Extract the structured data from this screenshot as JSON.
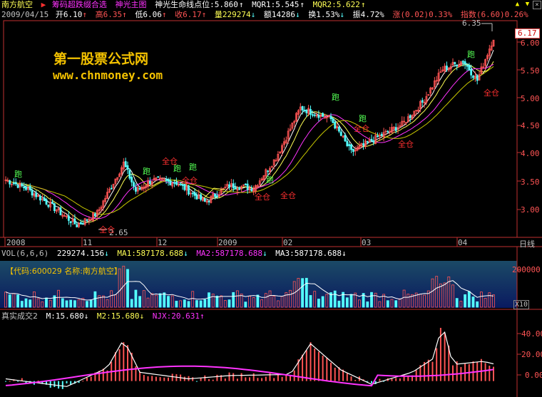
{
  "header": {
    "stock_name": "南方航空",
    "indicator_name": "筹码超跌缀合选",
    "main_chart_name": "神光主图",
    "lifeline_label": "神光生命线点位:",
    "lifeline_value": "5.860",
    "mqr1": "MQR1:5.545",
    "mqr2": "MQR2:5.622"
  },
  "quote": {
    "date": "2009/04/15",
    "open": "开6.10",
    "high": "高6.35",
    "low": "低6.06",
    "close": "收6.17",
    "volume": "量229274",
    "amount": "额14286",
    "turnover": "换1.53%",
    "amplitude": "振4.72%",
    "change": "涨(0.02)0.33%",
    "index": "指数(6.60)0.26%"
  },
  "watermark": {
    "line1": "第一股票公式网",
    "line2": "www.chnmoney.com"
  },
  "price_axis": {
    "ticks": [
      "6.00",
      "5.50",
      "5.00",
      "4.50",
      "4.00",
      "3.50",
      "3.00"
    ],
    "current": "6.17",
    "high_label": "6.35",
    "low_label": "2.65"
  },
  "time_axis": {
    "labels": [
      "2008",
      "11",
      "12",
      "2009",
      "02",
      "03",
      "04"
    ],
    "period": "日线"
  },
  "signals": {
    "sell": "跑",
    "buy": "全仓"
  },
  "volume_panel": {
    "title": "VOL(6,6,6)",
    "value": "229274.156",
    "ma1": "MA1:587178.688",
    "ma2": "MA2:587178.688",
    "ma3": "MA3:587178.688",
    "code_label": "【代码:600029 名称:南方航空】",
    "tick": "200000",
    "scale": "X10"
  },
  "osc_panel": {
    "title": "真实成交2",
    "m": "M:15.680",
    "m2": "M2:15.680",
    "njx": "NJX:20.631",
    "ticks": [
      "40.00",
      "20.00",
      "0.00"
    ]
  },
  "colors": {
    "up": "#ff5454",
    "down": "#54ffff",
    "axis": "#c03030",
    "yellow": "#f4c200",
    "magenta": "#ff33ff"
  },
  "chart_data": [
    {
      "type": "line",
      "title": "神光主图",
      "x": [
        "2008-10",
        "2008-11",
        "2008-12",
        "2009-01",
        "2009-02",
        "2009-03",
        "2009-04"
      ],
      "ylim": [
        2.6,
        6.45
      ],
      "series": [
        {
          "name": "神光生命线",
          "values": [
            3.55,
            2.9,
            3.75,
            3.25,
            3.5,
            4.6,
            5.86
          ]
        },
        {
          "name": "MQR1",
          "values": [
            3.6,
            3.0,
            3.6,
            3.3,
            3.45,
            4.45,
            5.545
          ]
        },
        {
          "name": "MQR2",
          "values": [
            3.65,
            3.1,
            3.5,
            3.35,
            3.4,
            4.35,
            5.622
          ]
        }
      ],
      "current_close": 6.17,
      "period_high": 6.35,
      "period_low": 2.65
    },
    {
      "type": "bar",
      "title": "VOL(6,6,6)",
      "ylim": [
        0,
        260000
      ],
      "last_value": 229274.156,
      "ma1": 587178.688,
      "ma2": 587178.688,
      "ma3": 587178.688
    },
    {
      "type": "bar",
      "title": "真实成交2",
      "ylim": [
        -10,
        55
      ],
      "m": 15.68,
      "m2": 15.68,
      "njx": 20.631
    }
  ]
}
